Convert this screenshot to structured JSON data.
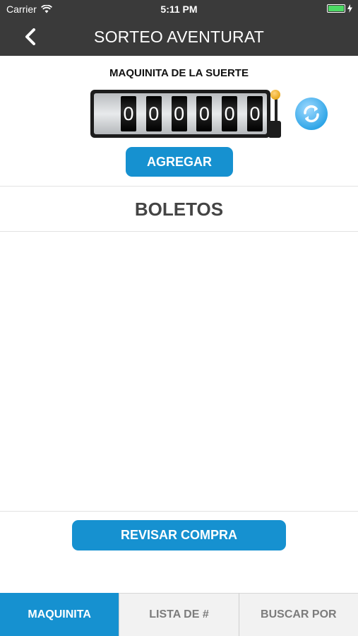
{
  "status_bar": {
    "carrier": "Carrier",
    "time": "5:11 PM"
  },
  "nav": {
    "title": "SORTEO AVENTURAT",
    "back_icon": "chevron-left-icon"
  },
  "machine": {
    "title": "MAQUINITA DE LA SUERTE",
    "digits": [
      "0",
      "0",
      "0",
      "0",
      "0",
      "0"
    ],
    "refresh_icon": "refresh-icon",
    "add_label": "AGREGAR"
  },
  "tickets": {
    "heading": "BOLETOS",
    "items": []
  },
  "review_label": "REVISAR COMPRA",
  "tabs": [
    {
      "label": "MAQUINITA",
      "active": true
    },
    {
      "label": "LISTA DE #",
      "active": false
    },
    {
      "label": "BUSCAR POR",
      "active": false
    }
  ],
  "colors": {
    "primary": "#1691d0",
    "bar_background": "#3a3a3a",
    "battery": "#4cd964",
    "lever_knob": "#e8a91e"
  }
}
